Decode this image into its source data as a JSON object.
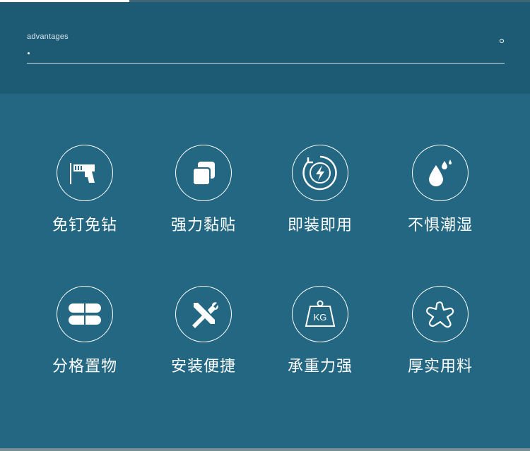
{
  "header": {
    "label": "advantages"
  },
  "features": [
    {
      "caption": "免钉免钻",
      "icon": "drill-icon"
    },
    {
      "caption": "强力黏贴",
      "icon": "adhesive-layers-icon"
    },
    {
      "caption": "即装即用",
      "icon": "lightning-power-icon"
    },
    {
      "caption": "不惧潮湿",
      "icon": "water-drop-icon"
    },
    {
      "caption": "分格置物",
      "icon": "compartments-icon"
    },
    {
      "caption": "安装便捷",
      "icon": "tools-icon"
    },
    {
      "caption": "承重力强",
      "icon": "kg-weight-icon"
    },
    {
      "caption": "厚实用料",
      "icon": "material-star-icon"
    }
  ],
  "weight_text": "KG",
  "colors": {
    "background": "#236782",
    "header": "#1d5a74",
    "foreground": "#ffffff"
  }
}
